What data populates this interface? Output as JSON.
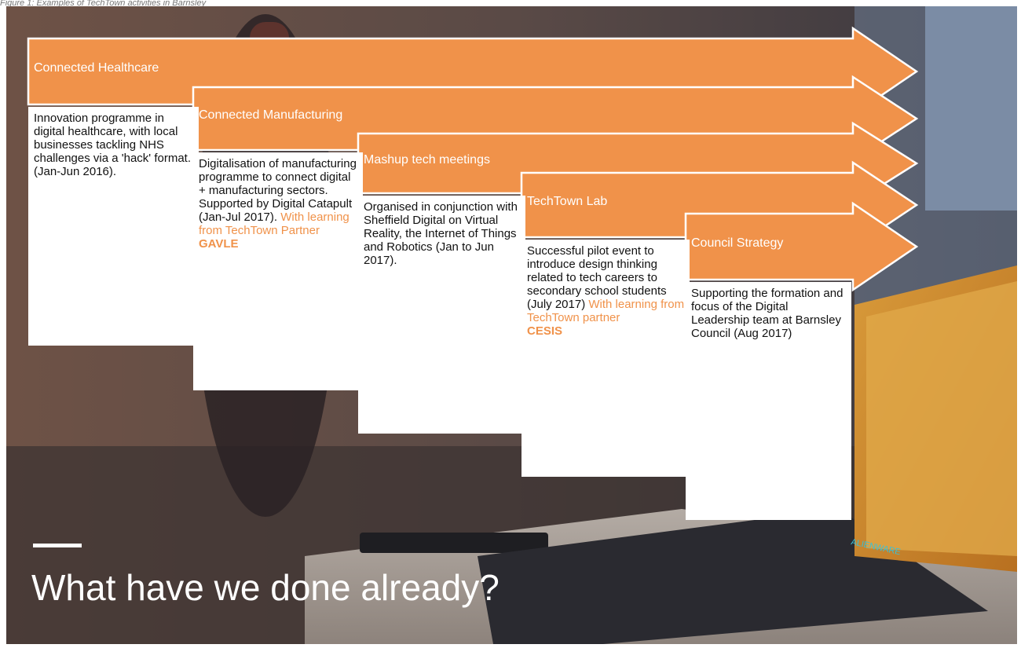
{
  "caption": "Figure 1: Examples of TechTown activities in Barnsley",
  "accent_color": "#f0924a",
  "title": "What have we done already?",
  "brand_text": "ALIENWARE",
  "steps": [
    {
      "label": "Connected Healthcare",
      "description": "Innovation programme in digital healthcare, with local businesses tackling NHS challenges via a 'hack' format. (Jan-Jun 2016).",
      "learning": "",
      "partner": ""
    },
    {
      "label": "Connected Manufacturing",
      "description": "Digitalisation of manufacturing programme to connect digital + manufacturing sectors. Supported by Digital Catapult (Jan-Jul 2017).",
      "learning": "With learning from TechTown Partner",
      "partner": "GAVLE"
    },
    {
      "label": "Mashup tech meetings",
      "description": "Organised in conjunction with Sheffield Digital on Virtual Reality, the Internet of Things and Robotics (Jan to Jun 2017).",
      "learning": "",
      "partner": ""
    },
    {
      "label": "TechTown Lab",
      "description": "Successful pilot event to introduce design thinking related to tech careers to secondary school students (July 2017)",
      "learning": "With learning from TechTown partner",
      "partner": "CESIS"
    },
    {
      "label": "Council Strategy",
      "description": "Supporting the formation and focus of the Digital Leadership team at Barnsley Council (Aug 2017)",
      "learning": "",
      "partner": ""
    }
  ]
}
